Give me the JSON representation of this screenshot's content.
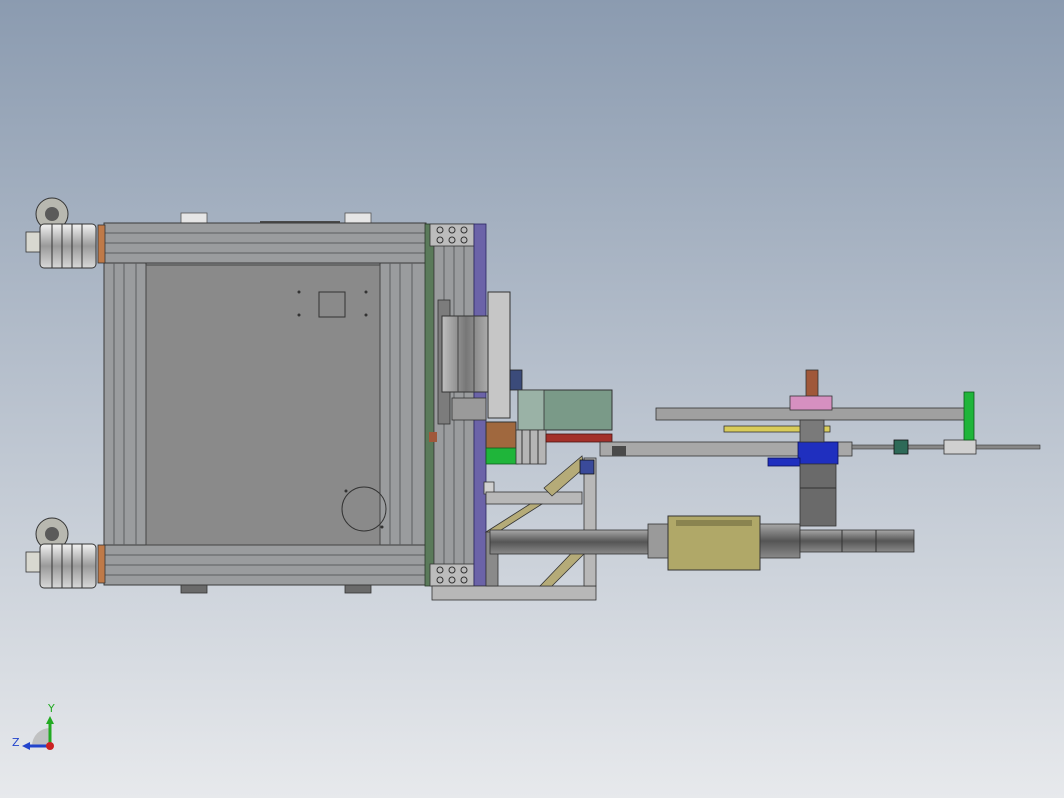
{
  "viewport": {
    "background": {
      "top_color": "#8b9bb0",
      "bottom_color": "#e7e9ec"
    }
  },
  "model": {
    "colors": {
      "frame": "#8d8f91",
      "frame_dark": "#5c5e60",
      "panel": "#8a8a8a",
      "plate_blue": "#6b63a8",
      "plate_green": "#5a7a5a",
      "motor_green": "#7a9a88",
      "tan": "#b5ab78",
      "blue_block": "#1f2fbf",
      "bright_green": "#1fb53a",
      "copper": "#8a5a3a",
      "pink": "#d690c0",
      "yellow": "#d8cc5a",
      "red": "#a3302a",
      "olive": "#b0a868"
    }
  },
  "triad": {
    "x_label": "",
    "y_label": "Y",
    "z_label": "Z",
    "colors": {
      "x": "#cc2222",
      "y": "#22aa22",
      "z": "#2244cc"
    }
  }
}
